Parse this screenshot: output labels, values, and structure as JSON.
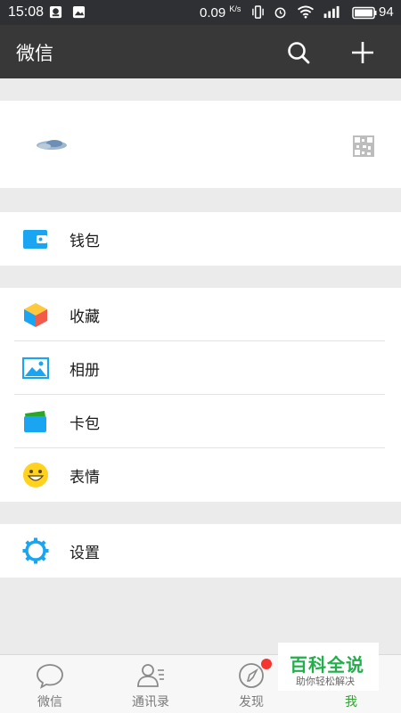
{
  "status_bar": {
    "time": "15:08",
    "speed_value": "0.09",
    "speed_unit": "K/s",
    "battery": "94",
    "icons": [
      "notification-icon",
      "image-icon",
      "vibrate-icon",
      "alarm-icon",
      "wifi-icon",
      "signal-icon",
      "battery-icon"
    ]
  },
  "header": {
    "title": "微信",
    "search_icon": "search-icon",
    "add_icon": "plus-icon"
  },
  "profile": {
    "avatar_icon": "avatar-cloud",
    "qr_icon": "qr-code-icon"
  },
  "menu": {
    "wallet": {
      "label": "钱包",
      "icon": "wallet-icon"
    },
    "favorites": {
      "label": "收藏",
      "icon": "cube-icon"
    },
    "album": {
      "label": "相册",
      "icon": "photo-icon"
    },
    "cards": {
      "label": "卡包",
      "icon": "card-icon"
    },
    "stickers": {
      "label": "表情",
      "icon": "smiley-icon"
    },
    "settings": {
      "label": "设置",
      "icon": "gear-icon"
    }
  },
  "tabs": [
    {
      "label": "微信",
      "icon": "chat-bubble-icon",
      "active": false
    },
    {
      "label": "通讯录",
      "icon": "contacts-icon",
      "active": false
    },
    {
      "label": "发现",
      "icon": "compass-icon",
      "active": false,
      "badge": true
    },
    {
      "label": "我",
      "icon": "me-icon",
      "active": true
    }
  ],
  "watermark": {
    "title": "百科全说",
    "subtitle": "助你轻松解决"
  },
  "colors": {
    "header_bg": "#383838",
    "status_bg": "#2f3033",
    "page_bg": "#ebebeb",
    "active_tab": "#2aa52a",
    "badge": "#f43530",
    "accent_blue": "#1aa5f2"
  }
}
